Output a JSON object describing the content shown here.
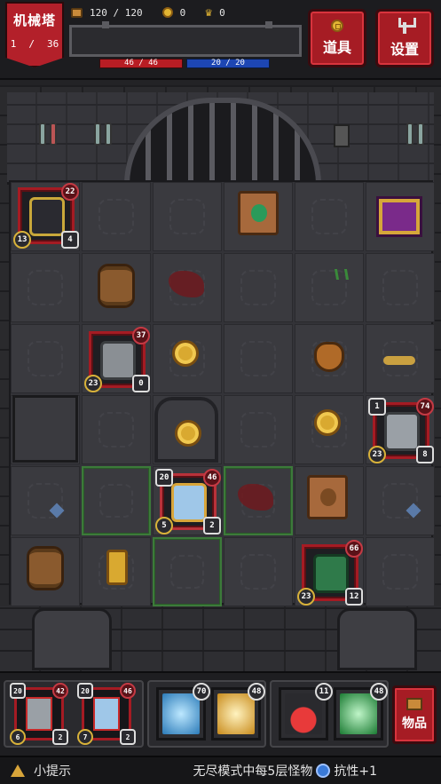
{
  "header": {
    "tower_name": "机械塔",
    "floor_current": "1",
    "floor_sep": "/",
    "floor_total": "36",
    "hp_pair": "120 / 120",
    "gold": "0",
    "crowns": "0",
    "hp_bar": "46 / 46",
    "mp_bar": "20 / 20",
    "items_button": "道具",
    "settings_button": "设置"
  },
  "board": {
    "units": [
      {
        "name": "ghost-knight",
        "top_right": "22",
        "bottom_left": "13",
        "bottom_right": "4"
      },
      {
        "name": "gray-robot",
        "top_right": "37",
        "bottom_left": "23",
        "bottom_right": "0"
      },
      {
        "name": "armored-robot",
        "top_left": "1",
        "top_right": "74",
        "bottom_left": "23",
        "bottom_right": "8"
      },
      {
        "name": "hero-girl",
        "top_left": "20",
        "top_right": "46",
        "bottom_left": "5",
        "bottom_right": "2"
      },
      {
        "name": "green-orc",
        "top_right": "66",
        "bottom_left": "23",
        "bottom_right": "12"
      }
    ]
  },
  "party": {
    "members": [
      {
        "name": "gray-warrior",
        "top_left": "20",
        "top_right": "42",
        "bottom_left": "6",
        "bottom_right": "2"
      },
      {
        "name": "blue-priestess",
        "top_left": "20",
        "top_right": "46",
        "bottom_left": "7",
        "bottom_right": "2"
      }
    ],
    "skills": [
      {
        "name": "ice-lightning",
        "badge": "70",
        "color": "#3aa8e8"
      },
      {
        "name": "holy-cross",
        "badge": "48",
        "color": "#e8b23a"
      },
      {
        "name": "red-potion",
        "badge": "11",
        "color": "#c82a2a"
      },
      {
        "name": "green-vortex",
        "badge": "48",
        "color": "#2ab84a"
      }
    ],
    "goods_button": "物品"
  },
  "tip": {
    "label": "小提示",
    "text": "无尽模式中每5层怪物",
    "suffix": "抗性+1"
  },
  "colors": {
    "accent_red": "#a61c24",
    "hp": "#b81d24",
    "mp": "#1d46b3"
  }
}
